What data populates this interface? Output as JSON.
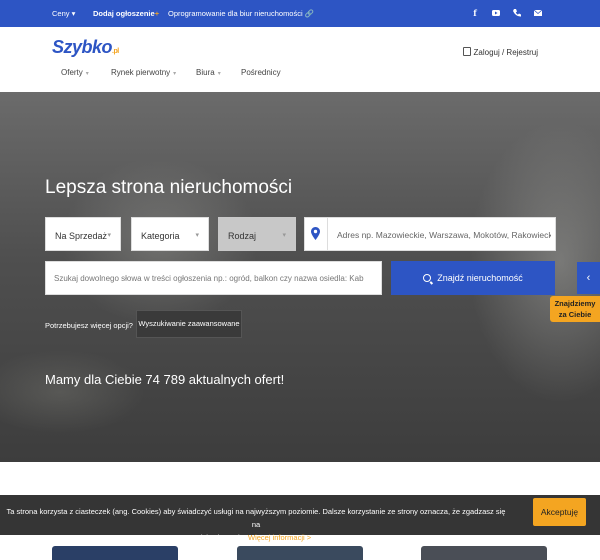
{
  "topbar": {
    "ceny": "Ceny ▾",
    "dodaj": "Dodaj ogłoszenie",
    "dodaj_plus": "+",
    "software": "Oprogramowanie dla biur nieruchomości",
    "icons": [
      "facebook-icon",
      "youtube-icon",
      "phone-icon",
      "mail-icon"
    ]
  },
  "header": {
    "logo": "Szybko",
    "logo_suffix": ".pl",
    "login": "Zaloguj / Rejestruj",
    "nav": [
      {
        "label": "Oferty"
      },
      {
        "label": "Rynek pierwotny"
      },
      {
        "label": "Biura"
      },
      {
        "label": "Pośrednicy"
      }
    ]
  },
  "search": {
    "title": "Lepsza strona nieruchomości",
    "transaction": "Na Sprzedaż",
    "category": "Kategoria",
    "type": "Rodzaj",
    "address_placeholder": "Adres np. Mazowieckie, Warszawa, Mokotów, Rakowiecka",
    "keyword_placeholder": "Szukaj dowolnego słowa w treści ogłoszenia np.: ogród, balkon czy nazwa osiedla: Kab",
    "find_button": "Znajdź nieruchomość",
    "more_options": "Potrzebujesz więcej opcji?",
    "advanced_button": "Wyszukiwanie zaawansowane",
    "offers_text": "Mamy dla Ciebie 74 789 aktualnych ofert!",
    "side_line1": "Znajdziemy",
    "side_line2": "za Ciebie",
    "side_arrow": "‹"
  },
  "cookie": {
    "text_line1": "Ta strona korzysta z ciasteczek (ang. Cookies) aby świadczyć usługi na najwyższym poziomie. Dalsze korzystanie ze strony oznacza, że zgadzasz się na",
    "text_line2": "ich używanie.",
    "link": "Więcej informacji >",
    "accept": "Akceptuję"
  },
  "colors": {
    "brand_blue": "#2d55c4",
    "accent_orange": "#f4a521"
  }
}
